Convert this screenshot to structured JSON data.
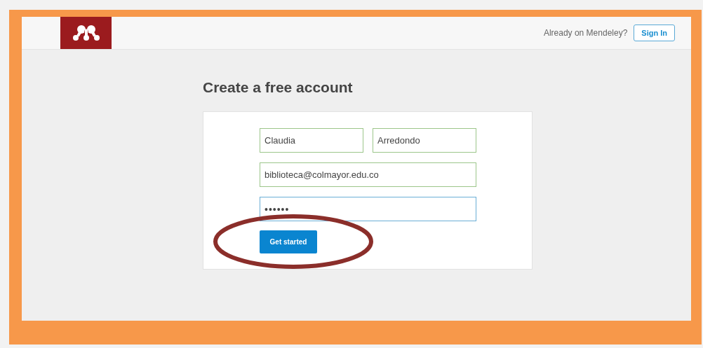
{
  "header": {
    "prompt": "Already on Mendeley?",
    "sign_in_button": "Sign In"
  },
  "heading": "Create a free account",
  "fields": [
    {
      "kind": "text",
      "value": "Claudia",
      "valid": true,
      "focused": false
    },
    {
      "kind": "text",
      "value": "Arredondo",
      "valid": true,
      "focused": false
    },
    {
      "kind": "text",
      "value": "biblioteca@colmayor.edu.co",
      "valid": true,
      "focused": false
    },
    {
      "kind": "password",
      "value": "••••••",
      "valid": false,
      "focused": true
    }
  ],
  "submit_button": "Get started",
  "annotation": {
    "kind": "ellipse",
    "color": "#8b2e2a"
  }
}
